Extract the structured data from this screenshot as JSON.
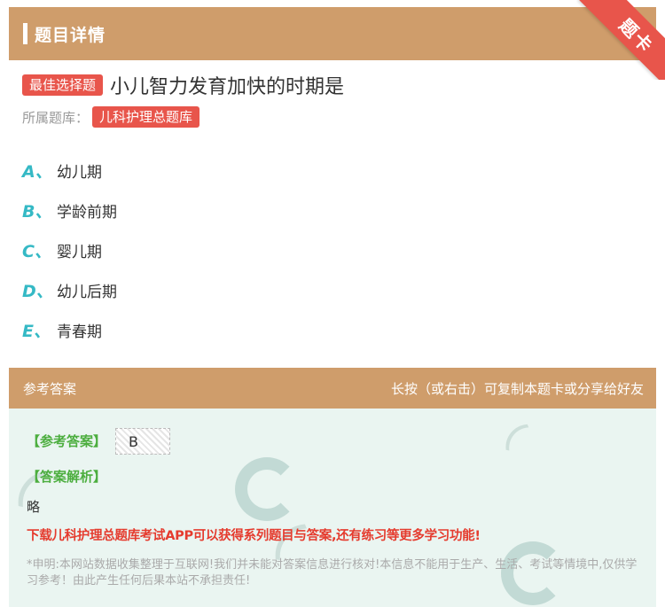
{
  "header": {
    "title": "题目详情",
    "corner_badge": "题卡"
  },
  "question": {
    "type_tag": "最佳选择题",
    "text": "小儿智力发育加快的时期是",
    "bank_label": "所属题库：",
    "bank_name": "儿科护理总题库"
  },
  "options": [
    {
      "letter": "A、",
      "text": "幼儿期"
    },
    {
      "letter": "B、",
      "text": "学龄前期"
    },
    {
      "letter": "C、",
      "text": "婴儿期"
    },
    {
      "letter": "D、",
      "text": "幼儿后期"
    },
    {
      "letter": "E、",
      "text": "青春期"
    }
  ],
  "answer_bar": {
    "left": "参考答案",
    "right": "长按（或右击）可复制本题卡或分享给好友"
  },
  "answer": {
    "answer_label": "【参考答案】",
    "answer_value": "B",
    "analysis_label": "【答案解析】",
    "analysis_text": "略",
    "download_text": "下载儿科护理总题库考试APP可以获得系列题目与答案,还有练习等更多学习功能!",
    "disclaimer": "*申明:本网站数据收集整理于互联网!我们并未能对答案信息进行核对!本信息不能用于生产、生活、考试等情境中,仅供学习参考！由此产生任何后果本站不承担责任!"
  },
  "colors": {
    "header": "#cf9d6b",
    "accent_red": "#e8554b",
    "option_letter": "#35b9c5",
    "answer_green": "#4cae3f",
    "panel_bg": "#eaf5f1"
  }
}
